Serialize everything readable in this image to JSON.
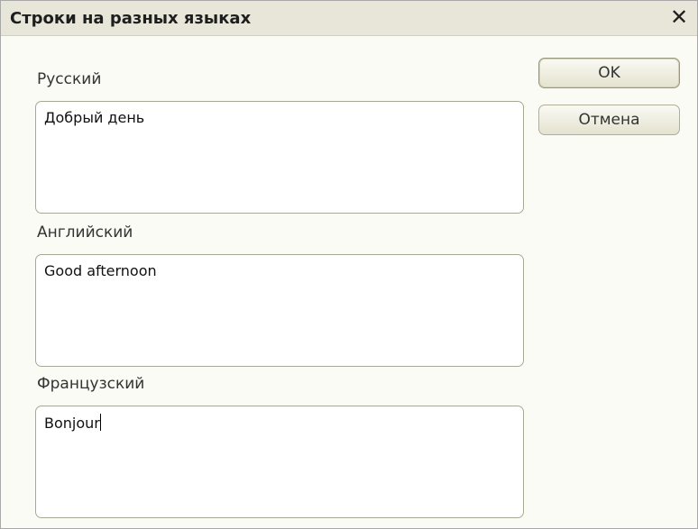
{
  "dialog": {
    "title": "Строки на разных языках",
    "close_glyph": "✕"
  },
  "fields": {
    "russian": {
      "label": "Русский",
      "value": "Добрый день"
    },
    "english": {
      "label": "Английский",
      "value": "Good afternoon"
    },
    "french": {
      "label": "Французский",
      "value": "Bonjour"
    }
  },
  "buttons": {
    "ok_label": "OK",
    "cancel_label": "Отмена"
  }
}
